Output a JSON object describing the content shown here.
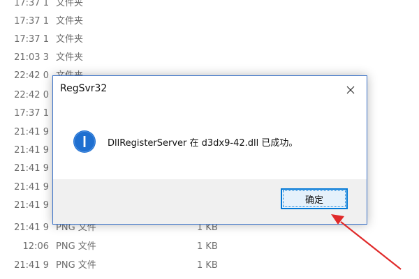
{
  "file_list": {
    "rows": [
      {
        "date": "1 17:37",
        "type": "文件夹",
        "size": ""
      },
      {
        "date": "1 17:37",
        "type": "文件夹",
        "size": ""
      },
      {
        "date": "1 17:37",
        "type": "文件夹",
        "size": ""
      },
      {
        "date": "3 21:03",
        "type": "文件夹",
        "size": ""
      },
      {
        "date": "0 22:42",
        "type": "文件夹",
        "size": ""
      },
      {
        "date": "0 22:42",
        "type": "",
        "size": ""
      },
      {
        "date": "1 17:37",
        "type": "",
        "size": ""
      },
      {
        "date": "9 21:41",
        "type": "",
        "size": ""
      },
      {
        "date": "9 21:41",
        "type": "",
        "size": ""
      },
      {
        "date": "9 21:41",
        "type": "",
        "size": ""
      },
      {
        "date": "9 21:41",
        "type": "",
        "size": ""
      },
      {
        "date": "9 21:41",
        "type": "",
        "size": ""
      },
      {
        "date": "9 21:41",
        "type": "PNG 文件",
        "size": "1 KB"
      },
      {
        "date": "12:06",
        "type": "PNG 文件",
        "size": "1 KB"
      },
      {
        "date": "9 21:41",
        "type": "PNG 文件",
        "size": "1 KB"
      }
    ]
  },
  "dialog": {
    "title": "RegSvr32",
    "message": "DllRegisterServer 在 d3dx9-42.dll 已成功。",
    "ok_label": "确定",
    "icon": "info-icon",
    "close_icon": "close-icon"
  },
  "colors": {
    "accent": "#0078d7",
    "info_icon": "#1f6fd0",
    "arrow": "#e02a2a",
    "footer_bg": "#f0f0f0"
  }
}
